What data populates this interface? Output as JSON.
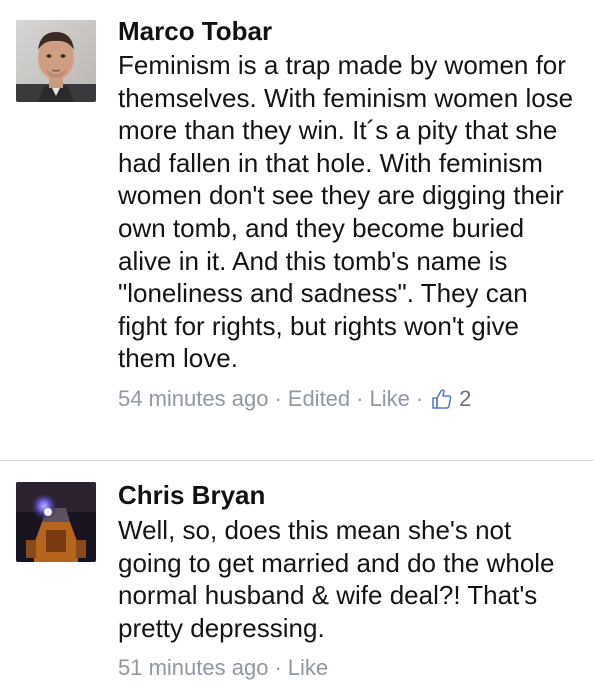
{
  "comments": [
    {
      "author": "Marco Tobar",
      "avatar_icon": "profile-photo",
      "text": "Feminism is a trap made by women for themselves. With feminism women lose more than they win. It´s a pity that she had fallen in that hole. With feminism women don't see they are digging their own tomb, and they become buried alive in it. And this tomb's name is \"loneliness and sadness\". They can fight for rights, but rights won't give them love.",
      "time": "54 minutes ago",
      "edited_label": "Edited",
      "like_label": "Like",
      "like_count": "2",
      "like_icon": "thumbs-up-icon"
    },
    {
      "author": "Chris Bryan",
      "avatar_icon": "profile-photo",
      "text": "Well, so, does this mean she's not going to get married and do the whole normal husband & wife deal?! That's pretty depressing.",
      "time": "51 minutes ago",
      "like_label": "Like"
    }
  ],
  "meta_separator": "·",
  "colors": {
    "meta_text": "#9197a3",
    "like_icon": "#5b7bd5",
    "divider": "#d9dce1"
  }
}
